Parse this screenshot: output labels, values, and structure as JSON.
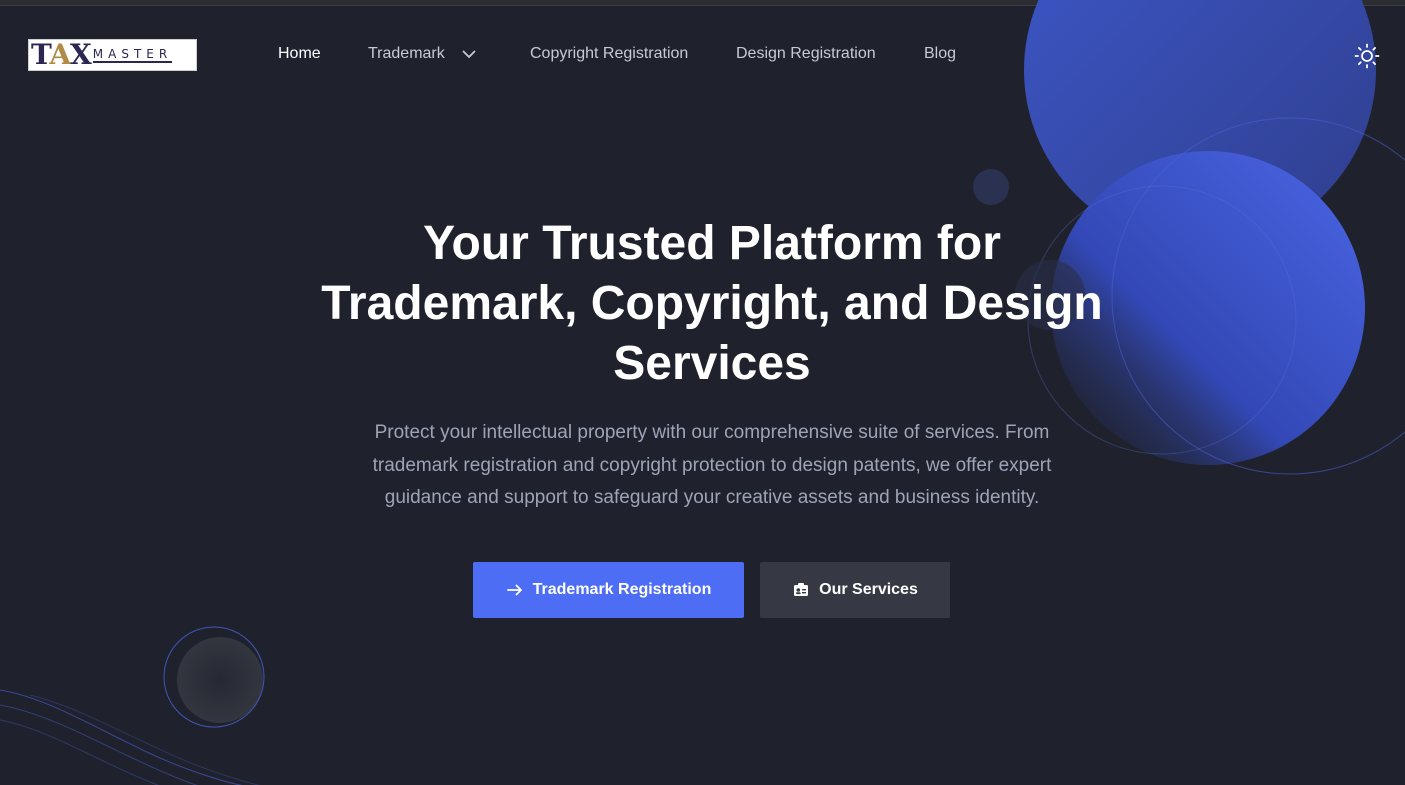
{
  "brand": {
    "logo_main_left": "T",
    "logo_main_mid": "A",
    "logo_main_right": "X",
    "logo_sub": "MASTER"
  },
  "nav": {
    "items": [
      {
        "label": "Home",
        "active": true
      },
      {
        "label": "Trademark",
        "has_dropdown": true
      },
      {
        "label": "Copyright Registration"
      },
      {
        "label": "Design Registration"
      },
      {
        "label": "Blog"
      }
    ],
    "theme_toggle_icon": "sun-icon"
  },
  "hero": {
    "title_lines": [
      "Your Trusted Platform for",
      "Trademark, Copyright, and Design",
      "Services"
    ],
    "description_lines": [
      "Protect your intellectual property with our comprehensive suite of services. From",
      "trademark registration and copyright protection to design patents, we offer expert",
      "guidance and support to safeguard your creative assets and business identity."
    ],
    "primary_button": {
      "label": "Trademark Registration",
      "icon": "arrow-right-icon"
    },
    "secondary_button": {
      "label": "Our Services",
      "icon": "services-card-icon"
    }
  },
  "colors": {
    "background": "#1f222d",
    "accent": "#4e6df5",
    "secondary_button": "#363944",
    "muted_text": "#9ea4b8"
  }
}
